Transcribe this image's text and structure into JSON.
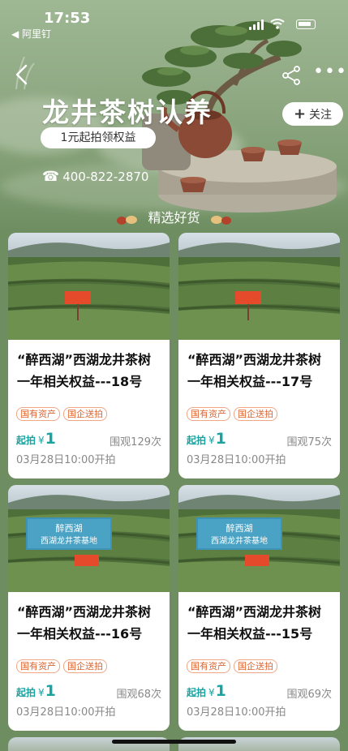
{
  "status_bar": {
    "time": "17:53",
    "carrier": "◀ 阿里钉"
  },
  "header": {
    "title": "龙井茶树认养",
    "promo_pill": "1元起拍领权益",
    "follow_label": "关注",
    "phone": "400-822-2870"
  },
  "section_title": "精选好货",
  "colors": {
    "background": "#6e8e61",
    "price": "#1aa3a0",
    "tag": "#e0642e"
  },
  "products": [
    {
      "title": "“醉西湖”西湖龙井茶树一年相关权益---18号",
      "tags": [
        "国有资产",
        "国企送拍"
      ],
      "price_label": "起拍",
      "currency": "¥",
      "price": "1",
      "views": "围观129次",
      "start_time": "03月28日10:00开拍",
      "sign_text": ""
    },
    {
      "title": "“醉西湖”西湖龙井茶树一年相关权益---17号",
      "tags": [
        "国有资产",
        "国企送拍"
      ],
      "price_label": "起拍",
      "currency": "¥",
      "price": "1",
      "views": "围观75次",
      "start_time": "03月28日10:00开拍",
      "sign_text": ""
    },
    {
      "title": "“醉西湖”西湖龙井茶树一年相关权益---16号",
      "tags": [
        "国有资产",
        "国企送拍"
      ],
      "price_label": "起拍",
      "currency": "¥",
      "price": "1",
      "views": "围观68次",
      "start_time": "03月28日10:00开拍",
      "sign_text": "醉西湖 西湖龙井茶基地"
    },
    {
      "title": "“醉西湖”西湖龙井茶树一年相关权益---15号",
      "tags": [
        "国有资产",
        "国企送拍"
      ],
      "price_label": "起拍",
      "currency": "¥",
      "price": "1",
      "views": "围观69次",
      "start_time": "03月28日10:00开拍",
      "sign_text": "醉西湖 西湖龙井茶基地"
    }
  ]
}
